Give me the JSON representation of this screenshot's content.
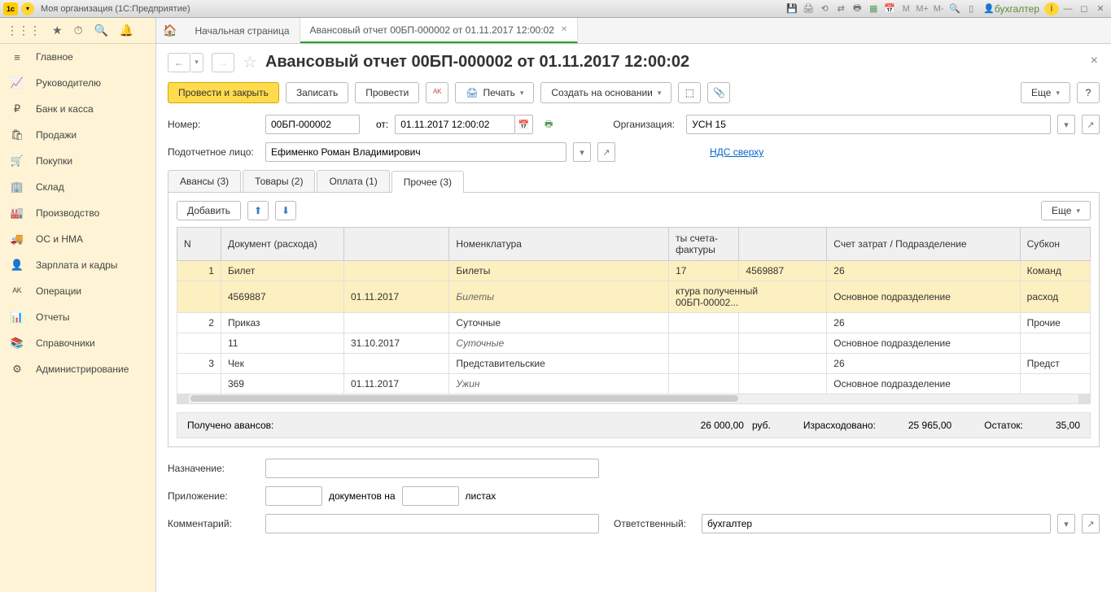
{
  "titlebar": {
    "app_title": "Моя организация  (1С:Предприятие)",
    "user": "бухгалтер",
    "m_labels": [
      "M",
      "M+",
      "M-"
    ]
  },
  "sidebar": {
    "items": [
      {
        "icon": "≡",
        "label": "Главное"
      },
      {
        "icon": "📈",
        "label": "Руководителю"
      },
      {
        "icon": "₽",
        "label": "Банк и касса"
      },
      {
        "icon": "🛍",
        "label": "Продажи"
      },
      {
        "icon": "🛒",
        "label": "Покупки"
      },
      {
        "icon": "🏢",
        "label": "Склад"
      },
      {
        "icon": "🏭",
        "label": "Производство"
      },
      {
        "icon": "🚚",
        "label": "ОС и НМА"
      },
      {
        "icon": "👤",
        "label": "Зарплата и кадры"
      },
      {
        "icon": "ᴬᴷ",
        "label": "Операции"
      },
      {
        "icon": "📊",
        "label": "Отчеты"
      },
      {
        "icon": "📚",
        "label": "Справочники"
      },
      {
        "icon": "⚙",
        "label": "Администрирование"
      }
    ]
  },
  "page_tabs": {
    "home": "Начальная страница",
    "active": "Авансовый отчет 00БП-000002 от 01.11.2017 12:00:02"
  },
  "doc": {
    "title": "Авансовый отчет 00БП-000002 от 01.11.2017 12:00:02"
  },
  "toolbar": {
    "post_close": "Провести и закрыть",
    "write": "Записать",
    "post": "Провести",
    "print": "Печать",
    "create_based": "Создать на основании",
    "more": "Еще",
    "help": "?"
  },
  "form": {
    "number_label": "Номер:",
    "number": "00БП-000002",
    "date_label": "от:",
    "date": "01.11.2017 12:00:02",
    "org_label": "Организация:",
    "org": "УСН 15",
    "person_label": "Подотчетное лицо:",
    "person": "Ефименко Роман Владимирович",
    "vat_link": "НДС сверху"
  },
  "inner_tabs": [
    "Авансы (3)",
    "Товары (2)",
    "Оплата (1)",
    "Прочее (3)"
  ],
  "tab_toolbar": {
    "add": "Добавить",
    "more": "Еще"
  },
  "grid": {
    "headers": [
      "N",
      "Документ (расхода)",
      "",
      "Номенклатура",
      "ты счета-фактуры",
      "",
      "Счет затрат / Подразделение",
      "Субкон"
    ],
    "rows": [
      {
        "n": "1",
        "doc": "Билет",
        "doc2": "",
        "nom": "Билеты",
        "sf1": "17",
        "sf2": "4569887",
        "cost": "26",
        "sub": "Команд"
      },
      {
        "n": "",
        "doc": "4569887",
        "doc2": "01.11.2017",
        "nom": "Билеты",
        "sf1": "ктура полученный 00БП-00002...",
        "sf2": "",
        "cost": "Основное подразделение",
        "sub": "расход"
      },
      {
        "n": "2",
        "doc": "Приказ",
        "doc2": "",
        "nom": "Суточные",
        "sf1": "",
        "sf2": "",
        "cost": "26",
        "sub": "Прочие"
      },
      {
        "n": "",
        "doc": "11",
        "doc2": "31.10.2017",
        "nom": "Суточные",
        "sf1": "",
        "sf2": "",
        "cost": "Основное подразделение",
        "sub": ""
      },
      {
        "n": "3",
        "doc": "Чек",
        "doc2": "",
        "nom": "Представительские",
        "sf1": "",
        "sf2": "",
        "cost": "26",
        "sub": "Предст"
      },
      {
        "n": "",
        "doc": "369",
        "doc2": "01.11.2017",
        "nom": "Ужин",
        "sf1": "",
        "sf2": "",
        "cost": "Основное подразделение",
        "sub": ""
      }
    ]
  },
  "summary": {
    "received_label": "Получено авансов:",
    "received": "26 000,00",
    "currency": "руб.",
    "spent_label": "Израсходовано:",
    "spent": "25 965,00",
    "rest_label": "Остаток:",
    "rest": "35,00"
  },
  "bottom": {
    "purpose_label": "Назначение:",
    "attach_label": "Приложение:",
    "attach_docs": "документов на",
    "attach_sheets": "листах",
    "comment_label": "Комментарий:",
    "resp_label": "Ответственный:",
    "resp": "бухгалтер"
  }
}
